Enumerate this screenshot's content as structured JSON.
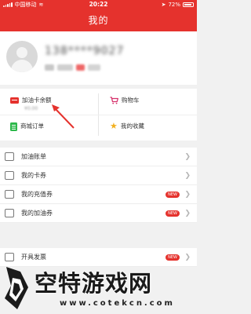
{
  "status_bar": {
    "carrier": "中国移动",
    "time": "20:22",
    "battery": "72%"
  },
  "header": {
    "title": "我的"
  },
  "profile": {
    "phone": "138****9027"
  },
  "quick": {
    "fuel_card_balance": "加油卡余额",
    "fuel_card_balance_sub": "¥0.00",
    "cart": "购物车",
    "mall_orders": "商城订单",
    "favorites": "我的收藏"
  },
  "menu": [
    {
      "label": "加油账单",
      "badge": ""
    },
    {
      "label": "我的卡券",
      "badge": ""
    },
    {
      "label": "我的充值券",
      "badge": "NEW"
    },
    {
      "label": "我的加油券",
      "badge": "NEW"
    }
  ],
  "menu2": [
    {
      "label": "开具发票",
      "badge": "NEW"
    }
  ],
  "watermark": {
    "title": "空特游戏网",
    "url": "www.cotekcn.com"
  },
  "colors": {
    "brand": "#e5322d",
    "cart": "#d6336c",
    "order": "#2db84b",
    "star": "#f2b01e"
  },
  "icons": {
    "card": "card-icon",
    "cart": "cart-icon",
    "order": "order-icon",
    "star": "star-icon",
    "bill": "bill-icon",
    "coupon": "coupon-icon",
    "chevron": "chevron-right-icon"
  }
}
